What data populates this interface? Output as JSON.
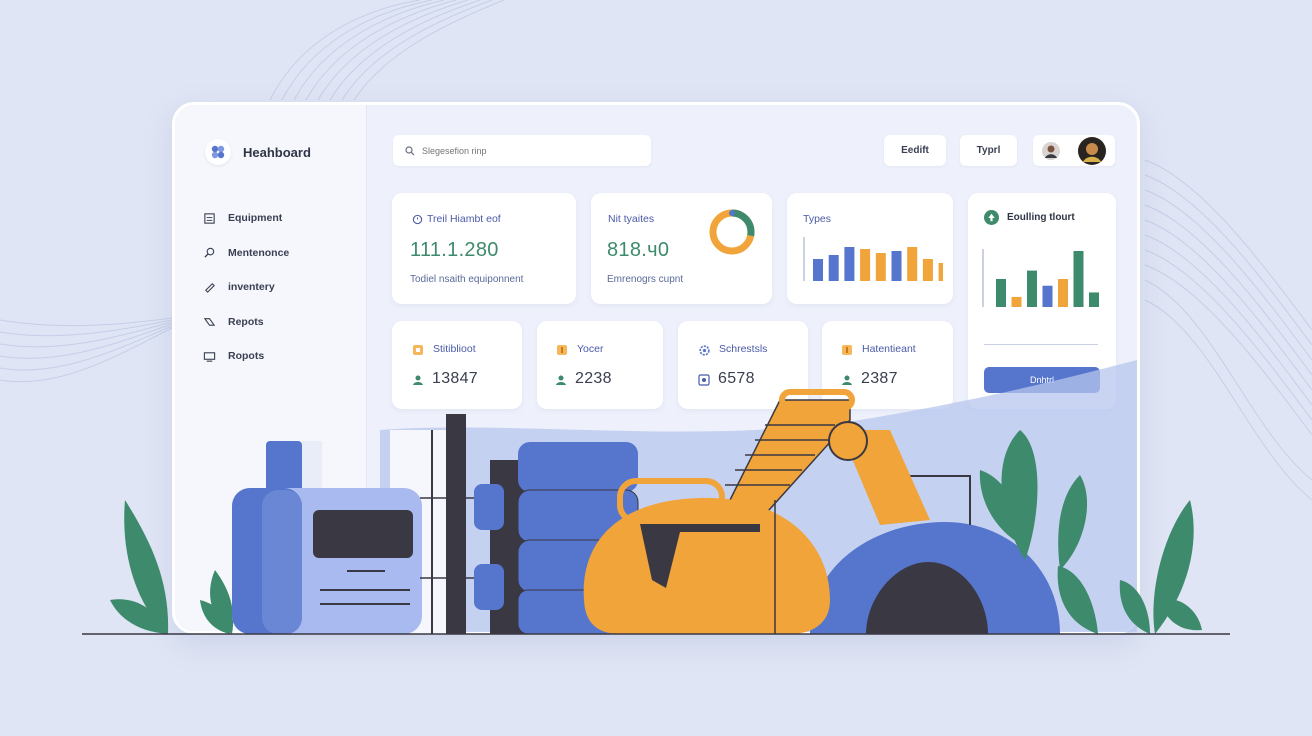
{
  "sidebar": {
    "brand": "Heahboard",
    "items": [
      {
        "label": "Equipment",
        "icon": "equipment-icon"
      },
      {
        "label": "Mentenonce",
        "icon": "maintenance-icon"
      },
      {
        "label": "inventery",
        "icon": "inventory-icon"
      },
      {
        "label": "Repots",
        "icon": "reports-icon"
      },
      {
        "label": "Ropots",
        "icon": "monitor-icon"
      }
    ]
  },
  "header": {
    "search_placeholder": "Slegesefion rinp",
    "btn1": "Eedift",
    "btn2": "Typrl"
  },
  "cards": {
    "total": {
      "label": "Treil Hiambt eof",
      "value": "111.1.280",
      "sub": "Todiel nsaith equiponnent"
    },
    "rate": {
      "label": "Nit tyaites",
      "value": "818.ч0",
      "sub": "Emrenogrs cupnt",
      "donut_fraction": 0.72
    },
    "types": {
      "label": "Types",
      "bars": [
        0.55,
        0.65,
        0.85,
        0.8,
        0.7,
        0.75,
        0.85,
        0.55,
        0.45
      ]
    },
    "stat1": {
      "label": "Stitiblioot",
      "value": "13847"
    },
    "stat2": {
      "label": "Yocer",
      "value": "2238"
    },
    "stat3": {
      "label": "Schrestsls",
      "value": "6578"
    },
    "stat4": {
      "label": "Hatentieant",
      "value": "2387"
    },
    "panel": {
      "label": "Eoulling tlourt",
      "button": "Dnhtrl",
      "bars": [
        0.5,
        0.18,
        0.65,
        0.38,
        0.5,
        1.0,
        0.26
      ]
    }
  },
  "colors": {
    "accent": "#5576cc",
    "orange": "#f0a43a",
    "green": "#3d8a6c",
    "background": "#dfe5f4"
  }
}
